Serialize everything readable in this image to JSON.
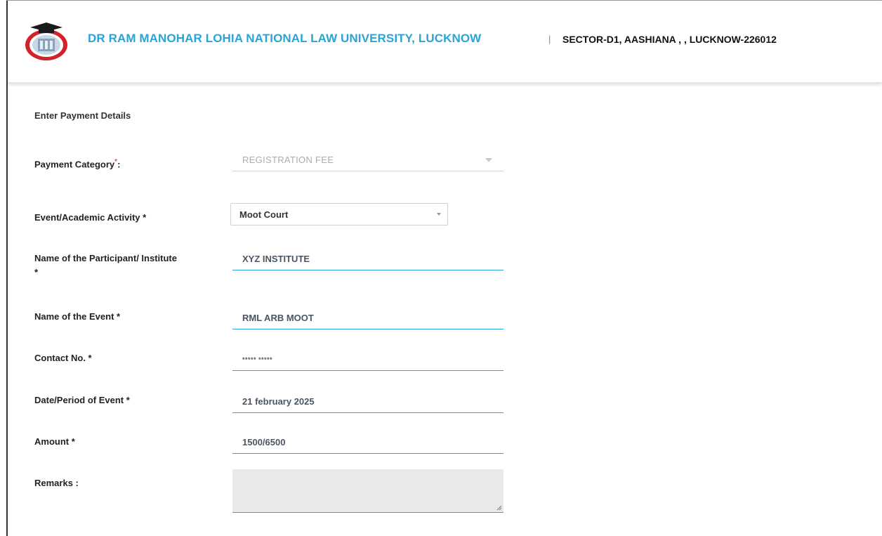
{
  "header": {
    "university_name": "DR RAM MANOHAR LOHIA NATIONAL LAW UNIVERSITY, LUCKNOW",
    "separator": "|",
    "address": "SECTOR-D1, AASHIANA , , LUCKNOW-226012",
    "logo_icon": "university-seal-icon"
  },
  "form": {
    "section_title": "Enter Payment Details",
    "payment_category": {
      "label": "Payment Category",
      "required_mark": "*",
      "suffix": ":",
      "value": "REGISTRATION FEE"
    },
    "event_activity": {
      "label": "Event/Academic Activity *",
      "value": "Moot Court"
    },
    "participant_name": {
      "label_line1": "Name of the Participant/ Institute",
      "label_line2": "*",
      "value": "XYZ INSTITUTE"
    },
    "event_name": {
      "label": "Name of the Event *",
      "value": "RML ARB MOOT"
    },
    "contact_no": {
      "label": "Contact No. *",
      "value": "***** *****"
    },
    "event_date": {
      "label": "Date/Period of Event *",
      "value": "21 february 2025"
    },
    "amount": {
      "label": "Amount *",
      "value": "1500/6500"
    },
    "remarks": {
      "label": "Remarks :",
      "value": ""
    }
  },
  "colors": {
    "brand_blue": "#29a4d8",
    "required_red": "#d9534f",
    "disabled_text": "#a7adb3",
    "textarea_bg": "#e7e9eb"
  }
}
